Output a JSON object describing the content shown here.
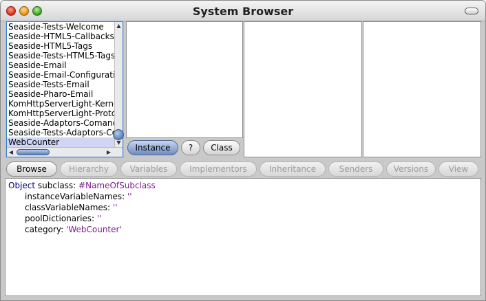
{
  "window": {
    "title": "System Browser"
  },
  "packages": [
    "Seaside-Tests-Welcome",
    "Seaside-HTML5-Callbacks",
    "Seaside-HTML5-Tags",
    "Seaside-Tests-HTML5-Tags",
    "Seaside-Email",
    "Seaside-Email-Configuration",
    "Seaside-Tests-Email",
    "Seaside-Pharo-Email",
    "KomHttpServerLight-Kernel",
    "KomHttpServerLight-Protocol",
    "Seaside-Adaptors-Comanche",
    "Seaside-Tests-Adaptors-Comanche",
    "WebCounter"
  ],
  "selected_package": "WebCounter",
  "class_switch": {
    "instance": "Instance",
    "help": "?",
    "class": "Class"
  },
  "toolbar": {
    "browse": "Browse",
    "hierarchy": "Hierarchy",
    "variables": "Variables",
    "implementors": "Implementors",
    "inheritance": "Inheritance",
    "senders": "Senders",
    "versions": "Versions",
    "view": "View"
  },
  "code": {
    "superclass": "Object",
    "subclass_kw": " subclass: ",
    "subclass_name": "#NameOfSubclass",
    "ivars_kw": "instanceVariableNames: ",
    "ivars_val": "''",
    "cvars_kw": "classVariableNames: ",
    "cvars_val": "''",
    "pools_kw": "poolDictionaries: ",
    "pools_val": "''",
    "category_kw": "category: ",
    "category_val": "'WebCounter'"
  }
}
